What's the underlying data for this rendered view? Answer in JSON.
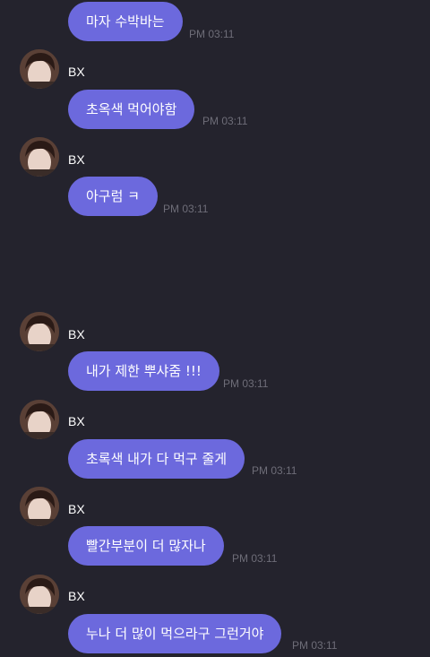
{
  "chat": {
    "messages": [
      {
        "text": "마자 수박바는",
        "time": "PM 03:11"
      },
      {
        "sender": "BX",
        "text": "초옥색 먹어야함",
        "time": "PM 03:11"
      },
      {
        "sender": "BX",
        "text": "아구럼 ㅋ",
        "time": "PM 03:11"
      },
      {
        "sender": "BX",
        "text": "내가 제한 뿌샤줌 !!!",
        "time": "PM 03:11"
      },
      {
        "sender": "BX",
        "text": "초록색 내가 다 먹구 줄게",
        "time": "PM 03:11"
      },
      {
        "sender": "BX",
        "text": "빨간부분이 더 많자나",
        "time": "PM 03:11"
      },
      {
        "sender": "BX",
        "text": "누나 더 많이 먹으라구 그런거야",
        "time": "PM 03:11"
      }
    ]
  },
  "colors": {
    "background": "#24232d",
    "bubble": "#6c69dd",
    "timestamp": "#6e6d78"
  },
  "icons": {
    "avatar": "profile-photo-avatar"
  }
}
